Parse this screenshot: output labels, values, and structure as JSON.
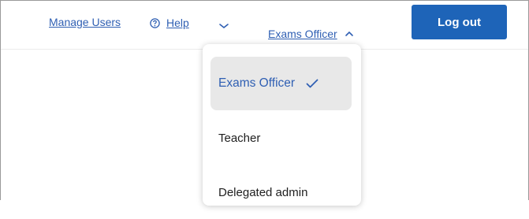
{
  "header": {
    "manage_users": "Manage Users",
    "help": "Help",
    "role_selector": "Exams Officer",
    "logout": "Log out"
  },
  "icons": {
    "help": "question-circle-icon",
    "expand": "chevron-down-icon",
    "collapse": "chevron-up-icon",
    "selected": "check-icon"
  },
  "role_menu": {
    "items": [
      {
        "label": "Exams Officer",
        "selected": true
      },
      {
        "label": "Teacher",
        "selected": false
      },
      {
        "label": "Delegated admin",
        "selected": false
      }
    ]
  },
  "colors": {
    "link": "#2f5fb3",
    "primary_button": "#1e64b8",
    "selected_bg": "#e8e8e8"
  }
}
